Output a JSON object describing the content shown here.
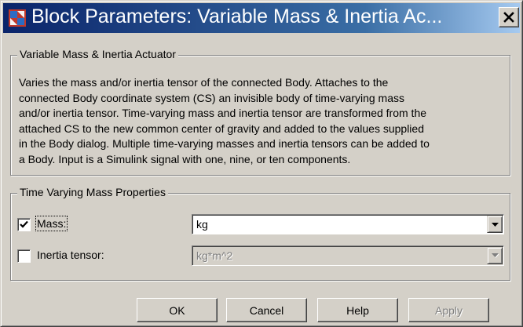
{
  "window": {
    "title": "Block Parameters: Variable Mass & Inertia Ac...",
    "close_glyph": "✕",
    "app_icon": "simulink-block-icon"
  },
  "description_group": {
    "title": "Variable Mass & Inertia Actuator",
    "text": "Varies the mass and/or inertia tensor of the connected Body. Attaches to the\nconnected Body coordinate system (CS) an invisible body of time-varying mass\nand/or inertia tensor. Time-varying mass and inertia tensor are transformed from the\nattached CS to the new common center of gravity and added to the values supplied\nin the Body dialog. Multiple time-varying masses and inertia tensors can be added to\na Body. Input is a Simulink signal with one, nine, or ten components."
  },
  "properties_group": {
    "title": "Time Varying Mass Properties",
    "mass": {
      "label": "Mass:",
      "checked": true,
      "unit": "kg"
    },
    "inertia": {
      "label": "Inertia tensor:",
      "checked": false,
      "unit": "kg*m^2",
      "disabled": true
    }
  },
  "buttons": {
    "ok": "OK",
    "cancel": "Cancel",
    "help": "Help",
    "apply": "Apply"
  },
  "colors": {
    "face": "#d4d0c8",
    "title_active_start": "#0a246a",
    "title_active_end": "#a6caf0"
  }
}
